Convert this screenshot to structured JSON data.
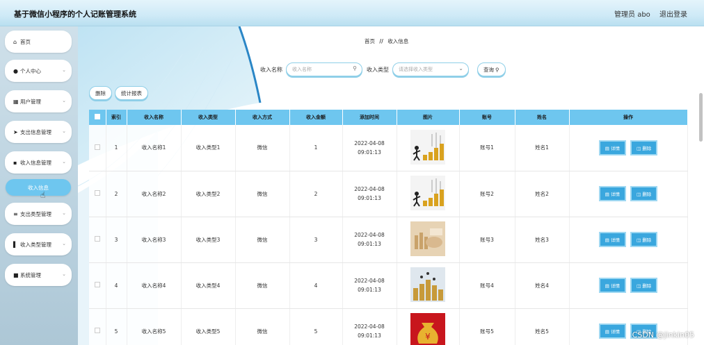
{
  "app": {
    "title": "基于微信小程序的个人记账管理系统"
  },
  "header": {
    "user_label": "管理员 abo",
    "logout_label": "退出登录"
  },
  "sidebar": {
    "items": [
      {
        "label": "首页",
        "icon": "home-icon",
        "glyph": "⌂"
      },
      {
        "label": "个人中心",
        "icon": "user-icon",
        "glyph": "●"
      },
      {
        "label": "用户管理",
        "icon": "grid-icon",
        "glyph": "▦"
      },
      {
        "label": "支出信息管理",
        "icon": "send-icon",
        "glyph": "➤"
      },
      {
        "label": "收入信息管理",
        "icon": "apps-icon",
        "glyph": "▪"
      },
      {
        "label": "收入信息",
        "icon": "",
        "glyph": ""
      },
      {
        "label": "支出类型管理",
        "icon": "sliders-icon",
        "glyph": "≡"
      },
      {
        "label": "收入类型管理",
        "icon": "chart-icon",
        "glyph": "▌"
      },
      {
        "label": "系统管理",
        "icon": "lock-icon",
        "glyph": "■"
      }
    ]
  },
  "breadcrumb": {
    "home": "首页",
    "sep": "//",
    "current": "收入信息"
  },
  "search": {
    "name_label": "收入名称",
    "name_placeholder": "收入名称",
    "type_label": "收入类型",
    "type_placeholder": "请选择收入类型",
    "query_label": "查询"
  },
  "actions": {
    "delete_label": "删除",
    "report_label": "统计报表"
  },
  "table": {
    "headers": [
      "索引",
      "收入名称",
      "收入类型",
      "收入方式",
      "收入金额",
      "添加时间",
      "图片",
      "账号",
      "姓名",
      "操作"
    ],
    "detail_label": "详情",
    "delete_label": "删除",
    "rows": [
      {
        "index": "1",
        "name": "收入名称1",
        "type": "收入类型1",
        "method": "微信",
        "amount": "1",
        "time": "2022-04-08 09:01:13",
        "account": "账号1",
        "person": "姓名1",
        "image": "stairs-coins"
      },
      {
        "index": "2",
        "name": "收入名称2",
        "type": "收入类型2",
        "method": "微信",
        "amount": "2",
        "time": "2022-04-08 09:01:13",
        "account": "账号2",
        "person": "姓名2",
        "image": "stairs-coins"
      },
      {
        "index": "3",
        "name": "收入名称3",
        "type": "收入类型3",
        "method": "微信",
        "amount": "3",
        "time": "2022-04-08 09:01:13",
        "account": "账号3",
        "person": "姓名3",
        "image": "coins-hand"
      },
      {
        "index": "4",
        "name": "收入名称4",
        "type": "收入类型4",
        "method": "微信",
        "amount": "4",
        "time": "2022-04-08 09:01:13",
        "account": "账号4",
        "person": "姓名4",
        "image": "people-coins"
      },
      {
        "index": "5",
        "name": "收入名称5",
        "type": "收入类型5",
        "method": "微信",
        "amount": "5",
        "time": "2022-04-08 09:01:13",
        "account": "账号5",
        "person": "姓名5",
        "image": "money-bag"
      }
    ]
  },
  "watermark": "CSDN @jinkin05",
  "colors": {
    "accent": "#6ec6ef",
    "button": "#3aa7de",
    "header_bg": "#cfeaf7"
  }
}
